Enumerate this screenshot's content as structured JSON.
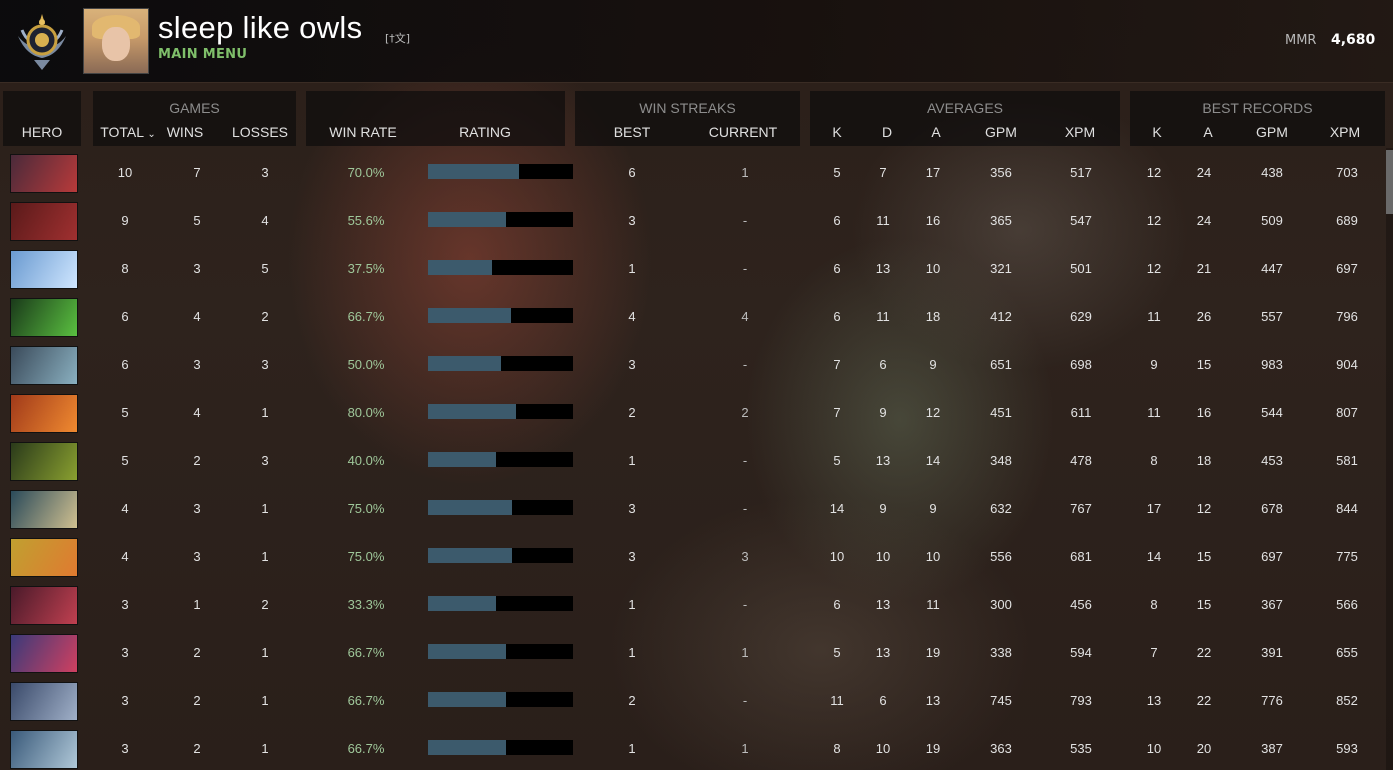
{
  "header": {
    "player_name": "sleep like owls",
    "player_tag": "[†文]",
    "main_menu": "MAIN MENU",
    "mmr_label": "MMR",
    "mmr_value": "4,680"
  },
  "groups": {
    "games": "GAMES",
    "win_streaks": "WIN STREAKS",
    "averages": "AVERAGES",
    "best_records": "BEST RECORDS"
  },
  "columns": {
    "hero": "HERO",
    "total": "TOTAL",
    "wins": "WINS",
    "losses": "LOSSES",
    "win_rate": "WIN RATE",
    "rating": "RATING",
    "best": "BEST",
    "current": "CURRENT",
    "k": "K",
    "d": "D",
    "a": "A",
    "gpm": "GPM",
    "xpm": "XPM",
    "best_k": "K",
    "best_a": "A",
    "best_gpm": "GPM",
    "best_xpm": "XPM"
  },
  "rows": [
    {
      "hero_icon": "shadow-demon-icon",
      "total": "10",
      "wins": "7",
      "losses": "3",
      "win_rate": "70.0%",
      "rating": 0.63,
      "best": "6",
      "current": "1",
      "k": "5",
      "d": "7",
      "a": "17",
      "gpm": "356",
      "xpm": "517",
      "bk": "12",
      "ba": "24",
      "bgpm": "438",
      "bxpm": "703",
      "colors": [
        "#4a2a3a",
        "#b83a3a"
      ]
    },
    {
      "hero_icon": "lion-icon",
      "total": "9",
      "wins": "5",
      "losses": "4",
      "win_rate": "55.6%",
      "rating": 0.54,
      "best": "3",
      "current": "-",
      "k": "6",
      "d": "11",
      "a": "16",
      "gpm": "365",
      "xpm": "547",
      "bk": "12",
      "ba": "24",
      "bgpm": "509",
      "bxpm": "689",
      "colors": [
        "#5a1a1a",
        "#a03030"
      ]
    },
    {
      "hero_icon": "crystal-maiden-icon",
      "total": "8",
      "wins": "3",
      "losses": "5",
      "win_rate": "37.5%",
      "rating": 0.44,
      "best": "1",
      "current": "-",
      "k": "6",
      "d": "13",
      "a": "10",
      "gpm": "321",
      "xpm": "501",
      "bk": "12",
      "ba": "21",
      "bgpm": "447",
      "bxpm": "697",
      "colors": [
        "#6a9ad0",
        "#cfe6ff"
      ]
    },
    {
      "hero_icon": "rubick-icon",
      "total": "6",
      "wins": "4",
      "losses": "2",
      "win_rate": "66.7%",
      "rating": 0.57,
      "best": "4",
      "current": "4",
      "k": "6",
      "d": "11",
      "a": "18",
      "gpm": "412",
      "xpm": "629",
      "bk": "11",
      "ba": "26",
      "bgpm": "557",
      "bxpm": "796",
      "colors": [
        "#1a3a1a",
        "#5ac040"
      ]
    },
    {
      "hero_icon": "tinker-icon",
      "total": "6",
      "wins": "3",
      "losses": "3",
      "win_rate": "50.0%",
      "rating": 0.5,
      "best": "3",
      "current": "-",
      "k": "7",
      "d": "6",
      "a": "9",
      "gpm": "651",
      "xpm": "698",
      "bk": "9",
      "ba": "15",
      "bgpm": "983",
      "bxpm": "904",
      "colors": [
        "#3a4a5a",
        "#8ab0c0"
      ]
    },
    {
      "hero_icon": "lina-icon",
      "total": "5",
      "wins": "4",
      "losses": "1",
      "win_rate": "80.0%",
      "rating": 0.61,
      "best": "2",
      "current": "2",
      "k": "7",
      "d": "9",
      "a": "12",
      "gpm": "451",
      "xpm": "611",
      "bk": "11",
      "ba": "16",
      "bgpm": "544",
      "bxpm": "807",
      "colors": [
        "#a03a1a",
        "#f08a30"
      ]
    },
    {
      "hero_icon": "venomancer-icon",
      "total": "5",
      "wins": "2",
      "losses": "3",
      "win_rate": "40.0%",
      "rating": 0.47,
      "best": "1",
      "current": "-",
      "k": "5",
      "d": "13",
      "a": "14",
      "gpm": "348",
      "xpm": "478",
      "bk": "8",
      "ba": "18",
      "bgpm": "453",
      "bxpm": "581",
      "colors": [
        "#2a3a1a",
        "#8aa030"
      ]
    },
    {
      "hero_icon": "witch-doctor-icon",
      "total": "4",
      "wins": "3",
      "losses": "1",
      "win_rate": "75.0%",
      "rating": 0.58,
      "best": "3",
      "current": "-",
      "k": "14",
      "d": "9",
      "a": "9",
      "gpm": "632",
      "xpm": "767",
      "bk": "17",
      "ba": "12",
      "bgpm": "678",
      "bxpm": "844",
      "colors": [
        "#2a4a5a",
        "#d0c090"
      ]
    },
    {
      "hero_icon": "windranger-icon",
      "total": "4",
      "wins": "3",
      "losses": "1",
      "win_rate": "75.0%",
      "rating": 0.58,
      "best": "3",
      "current": "3",
      "k": "10",
      "d": "10",
      "a": "10",
      "gpm": "556",
      "xpm": "681",
      "bk": "14",
      "ba": "15",
      "bgpm": "697",
      "bxpm": "775",
      "colors": [
        "#c0a030",
        "#e07a30"
      ]
    },
    {
      "hero_icon": "queen-of-pain-icon",
      "total": "3",
      "wins": "1",
      "losses": "2",
      "win_rate": "33.3%",
      "rating": 0.47,
      "best": "1",
      "current": "-",
      "k": "6",
      "d": "13",
      "a": "11",
      "gpm": "300",
      "xpm": "456",
      "bk": "8",
      "ba": "15",
      "bgpm": "367",
      "bxpm": "566",
      "colors": [
        "#4a1a2a",
        "#c04050"
      ]
    },
    {
      "hero_icon": "dark-willow-icon",
      "total": "3",
      "wins": "2",
      "losses": "1",
      "win_rate": "66.7%",
      "rating": 0.54,
      "best": "1",
      "current": "1",
      "k": "5",
      "d": "13",
      "a": "19",
      "gpm": "338",
      "xpm": "594",
      "bk": "7",
      "ba": "22",
      "bgpm": "391",
      "bxpm": "655",
      "colors": [
        "#3a3a7a",
        "#d04060"
      ]
    },
    {
      "hero_icon": "drow-ranger-icon",
      "total": "3",
      "wins": "2",
      "losses": "1",
      "win_rate": "66.7%",
      "rating": 0.54,
      "best": "2",
      "current": "-",
      "k": "11",
      "d": "6",
      "a": "13",
      "gpm": "745",
      "xpm": "793",
      "bk": "13",
      "ba": "22",
      "bgpm": "776",
      "bxpm": "852",
      "colors": [
        "#3a4a6a",
        "#a0b0c8"
      ]
    },
    {
      "hero_icon": "ancient-apparition-icon",
      "total": "3",
      "wins": "2",
      "losses": "1",
      "win_rate": "66.7%",
      "rating": 0.54,
      "best": "1",
      "current": "1",
      "k": "8",
      "d": "10",
      "a": "19",
      "gpm": "363",
      "xpm": "535",
      "bk": "10",
      "ba": "20",
      "bgpm": "387",
      "bxpm": "593",
      "colors": [
        "#3a5a7a",
        "#b0c8d8"
      ]
    }
  ]
}
